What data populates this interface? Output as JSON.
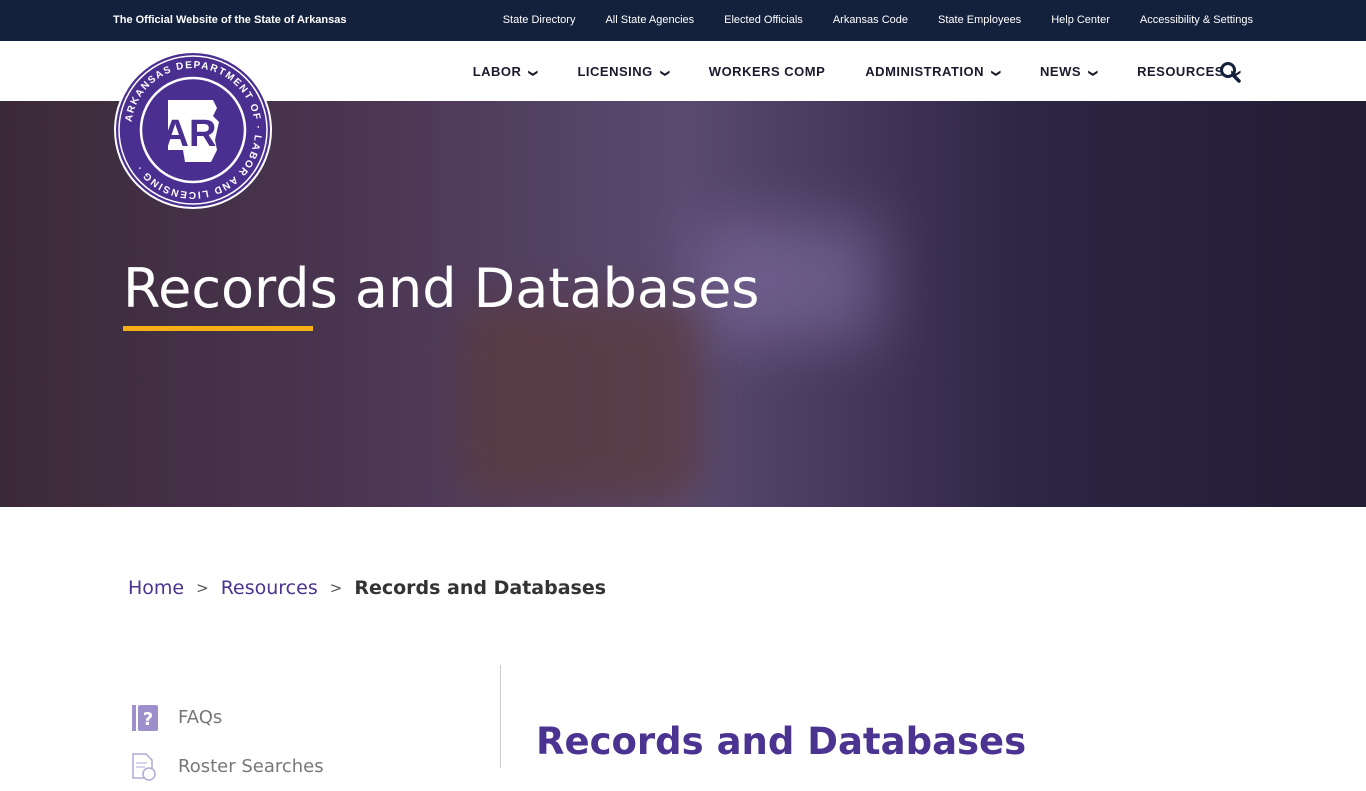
{
  "topbar": {
    "official": "The Official Website of the State of Arkansas",
    "links": [
      "State Directory",
      "All State Agencies",
      "Elected Officials",
      "Arkansas Code",
      "State Employees",
      "Help Center",
      "Accessibility & Settings"
    ]
  },
  "logo": {
    "text": "ARKANSAS DEPARTMENT OF LABOR AND LICENSING",
    "initials": "AR",
    "color": "#4a2f91"
  },
  "nav": {
    "items": [
      {
        "label": "LABOR",
        "dropdown": true
      },
      {
        "label": "LICENSING",
        "dropdown": true
      },
      {
        "label": "WORKERS COMP",
        "dropdown": false
      },
      {
        "label": "ADMINISTRATION",
        "dropdown": true
      },
      {
        "label": "NEWS",
        "dropdown": true
      },
      {
        "label": "RESOURCES",
        "dropdown": true
      }
    ],
    "search_icon": "search-icon"
  },
  "hero": {
    "title": "Records and Databases",
    "accent": "#f5b015"
  },
  "breadcrumb": {
    "home": "Home",
    "resources": "Resources",
    "current": "Records and Databases",
    "sep": ">"
  },
  "sidebar": {
    "items": [
      {
        "label": "FAQs",
        "icon": "question-book-icon"
      },
      {
        "label": "Roster Searches",
        "icon": "document-search-icon"
      }
    ]
  },
  "main": {
    "title": "Records and Databases"
  }
}
